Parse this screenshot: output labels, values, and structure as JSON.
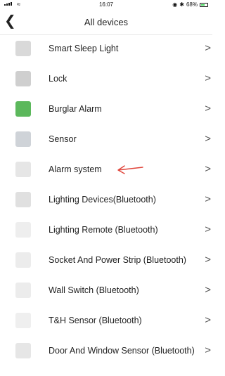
{
  "status": {
    "time": "16:07",
    "battery": "68%",
    "battery_level": 0.68,
    "icons": [
      "signal-icon",
      "wifi-icon",
      "location-icon",
      "bluetooth-icon",
      "battery-icon"
    ]
  },
  "nav": {
    "title": "All devices",
    "back_icon": "chevron-left-icon"
  },
  "devices": [
    {
      "label": "Smart Sleep Light",
      "thumb_color": "#d9d9d9"
    },
    {
      "label": "Lock",
      "thumb_color": "#cfcfcf"
    },
    {
      "label": "Burglar Alarm",
      "thumb_color": "#5cb85c"
    },
    {
      "label": "Sensor",
      "thumb_color": "#cfd3d8"
    },
    {
      "label": "Alarm system",
      "thumb_color": "#e6e6e6"
    },
    {
      "label": "Lighting Devices(Bluetooth)",
      "thumb_color": "#e0e0e0"
    },
    {
      "label": "Lighting Remote (Bluetooth)",
      "thumb_color": "#eeeeee"
    },
    {
      "label": "Socket And Power Strip (Bluetooth)",
      "thumb_color": "#ececec"
    },
    {
      "label": "Wall Switch (Bluetooth)",
      "thumb_color": "#ececec"
    },
    {
      "label": "T&H Sensor (Bluetooth)",
      "thumb_color": "#efefef"
    },
    {
      "label": "Door And Window Sensor (Bluetooth)",
      "thumb_color": "#e6e6e6"
    }
  ],
  "annotation": {
    "color": "#e0443a",
    "target": "Alarm system"
  },
  "colors": {
    "battery": "#4cd964",
    "chevron": "#555555"
  }
}
